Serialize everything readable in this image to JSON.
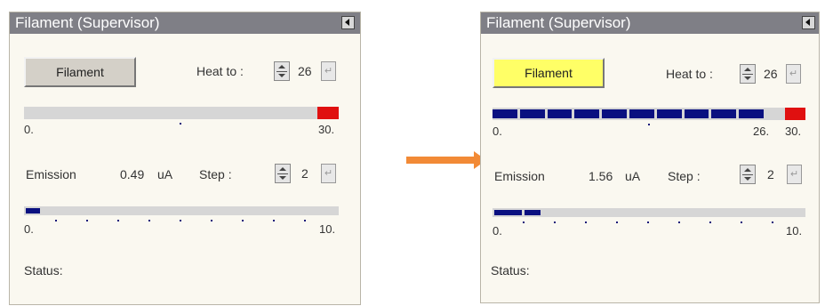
{
  "left": {
    "title": "Filament (Supervisor)",
    "filament_button": "Filament",
    "heat_label": "Heat to :",
    "heat_value": "26",
    "heat_scale_min": "0.",
    "heat_scale_max": "30.",
    "emission_label": "Emission",
    "emission_value": "0.49",
    "emission_unit": "uA",
    "step_label": "Step :",
    "step_value": "2",
    "emission_scale_min": "0.",
    "emission_scale_max": "10.",
    "status_label": "Status:"
  },
  "right": {
    "title": "Filament (Supervisor)",
    "filament_button": "Filament",
    "heat_label": "Heat to :",
    "heat_value": "26",
    "heat_scale_min": "0.",
    "heat_scale_mid": "26.",
    "heat_scale_max": "30.",
    "emission_label": "Emission",
    "emission_value": "1.56",
    "emission_unit": "uA",
    "step_label": "Step :",
    "step_value": "2",
    "emission_scale_min": "0.",
    "emission_scale_max": "10.",
    "status_label": "Status:"
  },
  "colors": {
    "title_bar": "#7f7f86",
    "panel_bg": "#faf8f0",
    "button_default": "#d4d0c8",
    "button_active": "#ffff66",
    "bar_fill": "#0a1080",
    "bar_track": "#d6d6d6",
    "limit_marker": "#e01010",
    "transition_arrow": "#f28a36"
  },
  "icons": {
    "window_button": "left-triangle-icon",
    "spinner": "up-down-spinner-icon",
    "enter": "enter-return-icon",
    "transition": "right-arrow-icon"
  },
  "levels": {
    "left_heat_fill_fraction": 0.0,
    "right_heat_fill_fraction": 0.8667,
    "left_emission_fraction": 0.049,
    "right_emission_fraction": 0.156
  }
}
